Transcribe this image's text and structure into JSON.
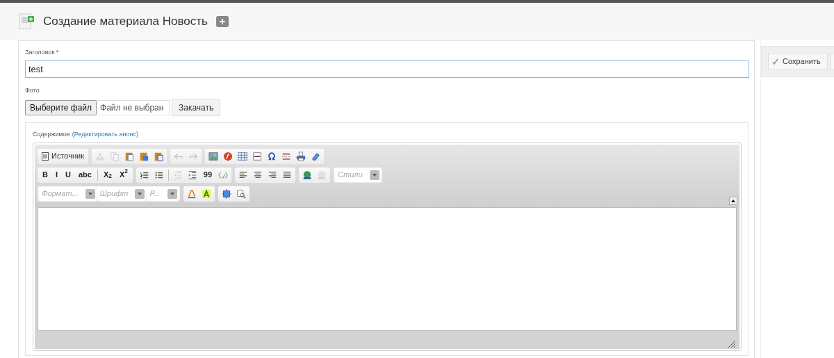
{
  "header": {
    "title": "Создание материала Новость"
  },
  "form": {
    "title_label": "Заголовок",
    "required_mark": "*",
    "title_value": "test",
    "photo_label": "Фото",
    "file_button": "Выберите файл",
    "file_status": "Файл не выбран",
    "upload_button": "Закачать",
    "content_label": "Содержимое",
    "content_link": "(Редактировать анонс)"
  },
  "toolbar": [
    [
      [
        {
          "kind": "button",
          "label": "Источник"
        }
      ],
      [
        {
          "kind": "icon",
          "disabled": true
        },
        {
          "kind": "icon",
          "disabled": true
        },
        {
          "kind": "icon",
          "disabled": false
        },
        {
          "kind": "icon",
          "disabled": false
        },
        {
          "kind": "icon",
          "disabled": false
        }
      ],
      [
        {
          "kind": "icon",
          "disabled": true
        },
        {
          "kind": "icon",
          "disabled": true
        }
      ],
      [
        {
          "kind": "icon",
          "disabled": false
        },
        {
          "kind": "icon",
          "disabled": false
        },
        {
          "kind": "icon",
          "disabled": false
        },
        {
          "kind": "icon",
          "disabled": false
        },
        {
          "kind": "icon",
          "disabled": false
        },
        {
          "kind": "icon",
          "disabled": false
        },
        {
          "kind": "icon",
          "disabled": false
        },
        {
          "kind": "icon",
          "disabled": false
        }
      ]
    ],
    [
      [
        {
          "kind": "glyph",
          "text": "B"
        },
        {
          "kind": "glyph",
          "text": "I"
        },
        {
          "kind": "glyph",
          "text": "U"
        },
        {
          "kind": "glyph",
          "text": "abc"
        },
        {
          "kind": "separator"
        },
        {
          "kind": "glyph",
          "text": "X$_{2}$"
        },
        {
          "kind": "glyph",
          "text": "X$^{2}$"
        }
      ],
      [
        {
          "kind": "icon",
          "disabled": false
        },
        {
          "kind": "icon",
          "disabled": false
        },
        {
          "kind": "separator"
        },
        {
          "kind": "icon",
          "disabled": true
        },
        {
          "kind": "icon",
          "disabled": false
        },
        {
          "kind": "glyph",
          "text": "99"
        },
        {
          "kind": "icon",
          "disabled": false
        }
      ],
      [
        {
          "kind": "icon",
          "disabled": false
        },
        {
          "kind": "icon",
          "disabled": false
        },
        {
          "kind": "icon",
          "disabled": false
        },
        {
          "kind": "icon",
          "disabled": false
        }
      ],
      [
        {
          "kind": "icon",
          "disabled": false
        },
        {
          "kind": "icon",
          "disabled": true
        }
      ],
      [
        {
          "kind": "combo",
          "placeholder": "Стили"
        }
      ]
    ],
    [
      [
        {
          "kind": "combo",
          "placeholder": "Формат..."
        },
        {
          "kind": "combo",
          "placeholder": "Шрифт"
        },
        {
          "kind": "combo",
          "placeholder": "Р..."
        }
      ],
      [
        {
          "kind": "icon",
          "disabled": false
        },
        {
          "kind": "icon",
          "disabled": false
        }
      ],
      [
        {
          "kind": "icon",
          "disabled": false
        },
        {
          "kind": "icon",
          "disabled": false
        }
      ]
    ]
  ],
  "sidebar": {
    "save_button": "Сохранить"
  }
}
